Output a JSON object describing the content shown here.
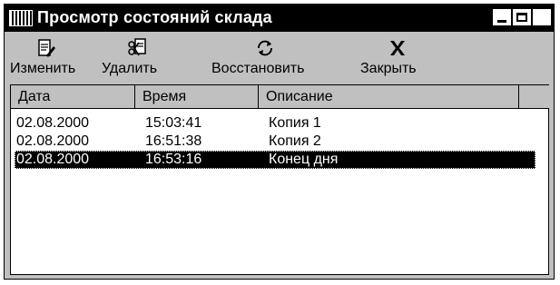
{
  "window": {
    "title": "Просмотр состояний склада",
    "controls": {
      "minimize": "_",
      "maximize": "□",
      "close": "✕"
    }
  },
  "toolbar": {
    "items": [
      {
        "label": "Изменить",
        "icon": "edit-document-icon"
      },
      {
        "label": "Удалить",
        "icon": "delete-document-icon"
      },
      {
        "label": "Восстановить",
        "icon": "restore-icon"
      },
      {
        "label": "Закрыть",
        "icon": "close-x-icon"
      }
    ]
  },
  "table": {
    "columns": [
      "Дата",
      "Время",
      "Описание"
    ],
    "rows": [
      {
        "date": "02.08.2000",
        "time": "15:03:41",
        "description": "Копия 1",
        "selected": false
      },
      {
        "date": "02.08.2000",
        "time": "16:51:38",
        "description": "Копия 2",
        "selected": false
      },
      {
        "date": "02.08.2000",
        "time": "16:53:16",
        "description": "Конец дня",
        "selected": true
      }
    ]
  },
  "colors": {
    "face": "#c0c0c0",
    "selection": "#000000",
    "titlebar": "#000000"
  }
}
